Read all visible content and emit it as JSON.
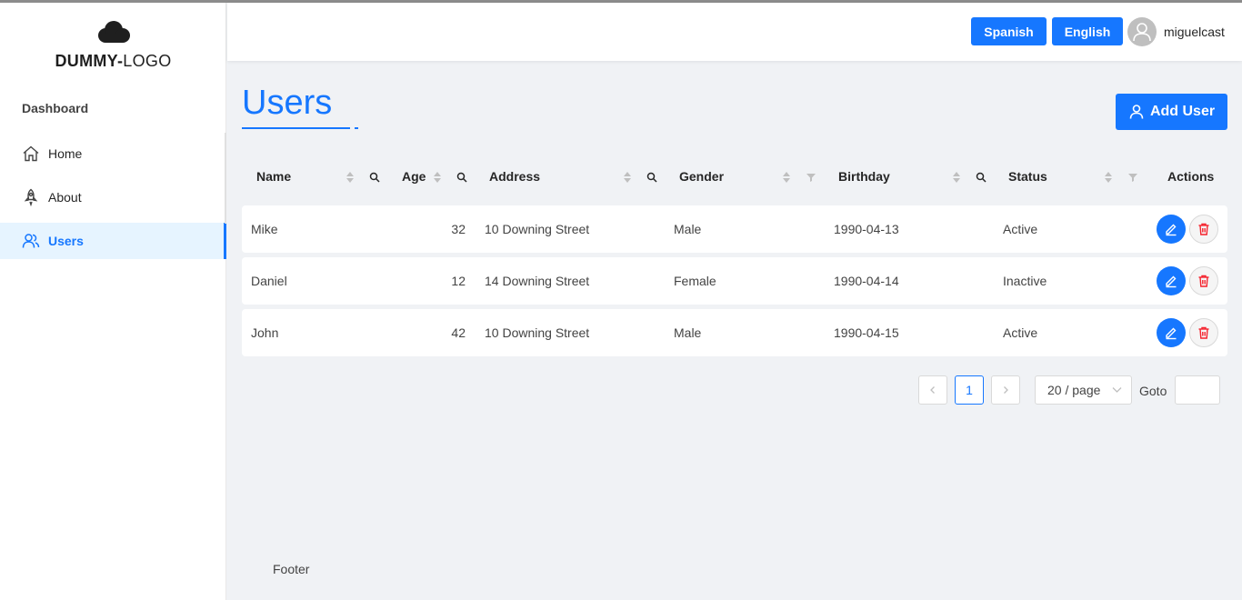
{
  "logo": {
    "bold": "DUMMY-",
    "light": "LOGO"
  },
  "sidebar": {
    "section_title": "Dashboard",
    "items": [
      {
        "label": "Home",
        "icon": "home-icon"
      },
      {
        "label": "About",
        "icon": "rocket-icon"
      },
      {
        "label": "Users",
        "icon": "users-icon",
        "active": true
      }
    ]
  },
  "header": {
    "languages": [
      "Spanish",
      "English"
    ],
    "username": "miguelcast"
  },
  "main": {
    "title": "Users",
    "add_button": "Add User",
    "table": {
      "columns": [
        "Name",
        "Age",
        "Address",
        "Gender",
        "Birthday",
        "Status",
        "Actions"
      ],
      "rows": [
        {
          "name": "Mike",
          "age": "32",
          "address": "10 Downing Street",
          "gender": "Male",
          "birthday": "1990-04-13",
          "status": "Active"
        },
        {
          "name": "Daniel",
          "age": "12",
          "address": "14 Downing Street",
          "gender": "Female",
          "birthday": "1990-04-14",
          "status": "Inactive"
        },
        {
          "name": "John",
          "age": "42",
          "address": "10 Downing Street",
          "gender": "Male",
          "birthday": "1990-04-15",
          "status": "Active"
        }
      ]
    },
    "pagination": {
      "current_page": "1",
      "page_size": "20 / page",
      "goto_label": "Goto"
    }
  },
  "footer": {
    "text": "Footer"
  },
  "colors": {
    "primary": "#1677ff",
    "danger": "#f5222d"
  }
}
